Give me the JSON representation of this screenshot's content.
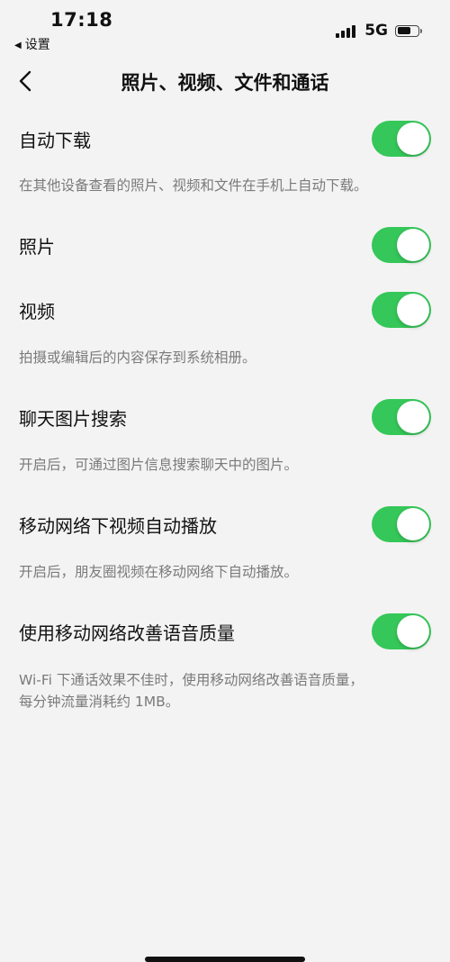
{
  "status": {
    "time": "17:18",
    "back_app": "设置",
    "network": "5G",
    "battery_level": 0.65,
    "signal_bars": 4
  },
  "nav": {
    "title": "照片、视频、文件和通话"
  },
  "settings": [
    {
      "label": "自动下载",
      "enabled": true
    },
    {
      "label": "照片",
      "enabled": true
    },
    {
      "label": "视频",
      "enabled": true
    },
    {
      "label": "聊天图片搜索",
      "enabled": true
    },
    {
      "label": "移动网络下视频自动播放",
      "enabled": true
    },
    {
      "label": "使用移动网络改善语音质量",
      "enabled": true
    }
  ],
  "descriptions": {
    "auto_download": "在其他设备查看的照片、视频和文件在手机上自动下载。",
    "video": "拍摄或编辑后的内容保存到系统相册。",
    "image_search": "开启后，可通过图片信息搜索聊天中的图片。",
    "autoplay": "开启后，朋友圈视频在移动网络下自动播放。",
    "voice_quality_line1": "Wi-Fi 下通话效果不佳时，使用移动网络改善语音质量，",
    "voice_quality_line2": "每分钟流量消耗约 1MB。"
  },
  "colors": {
    "toggle_on": "#35c759",
    "background": "#f3f3f3",
    "description_text": "#7a7a7a"
  }
}
